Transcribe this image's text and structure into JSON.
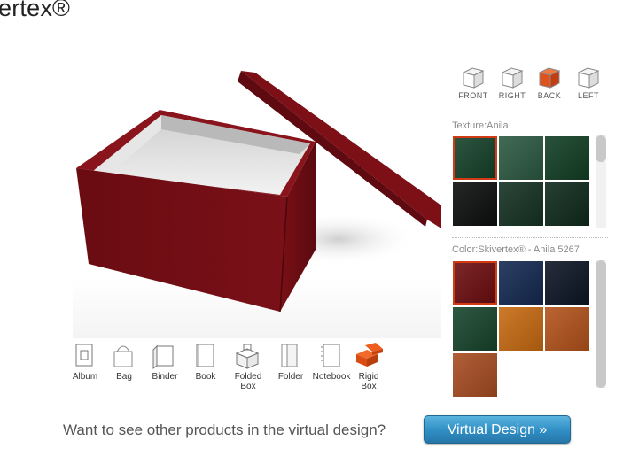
{
  "page": {
    "title": "ertex®"
  },
  "views": [
    {
      "label": "FRONT",
      "active": false
    },
    {
      "label": "RIGHT",
      "active": false
    },
    {
      "label": "BACK",
      "active": true
    },
    {
      "label": "LEFT",
      "active": false
    }
  ],
  "texture": {
    "label": "Texture:Anila",
    "swatches": [
      {
        "color": "#15422a",
        "selected": true
      },
      {
        "color": "#2c5a42"
      },
      {
        "color": "#123f24"
      },
      {
        "color": "#0c0f0e"
      },
      {
        "color": "#163224"
      },
      {
        "color": "#0f2a1c"
      }
    ]
  },
  "colors": {
    "label": "Color:Skivertex® - Anila 5267",
    "swatches": [
      {
        "color": "#6e0e10",
        "selected": true
      },
      {
        "color": "#152a52"
      },
      {
        "color": "#0d1626"
      },
      {
        "color": "#17452c"
      },
      {
        "color": "#c86b12"
      },
      {
        "color": "#b4531b"
      },
      {
        "color": "#a84d22"
      }
    ]
  },
  "products": [
    {
      "label": "Album",
      "icon": "album-icon"
    },
    {
      "label": "Bag",
      "icon": "bag-icon"
    },
    {
      "label": "Binder",
      "icon": "binder-icon"
    },
    {
      "label": "Book",
      "icon": "book-icon"
    },
    {
      "label": "Folded Box",
      "icon": "folded-box-icon"
    },
    {
      "label": "Folder",
      "icon": "folder-icon"
    },
    {
      "label": "Notebook",
      "icon": "notebook-icon"
    },
    {
      "label": "Rigid Box",
      "icon": "rigid-box-icon",
      "active": true
    }
  ],
  "cta": {
    "text": "Want to see other products in the virtual design?",
    "button": "Virtual Design »"
  },
  "box": {
    "color": "#6b0c12",
    "inner": "#ececec"
  }
}
